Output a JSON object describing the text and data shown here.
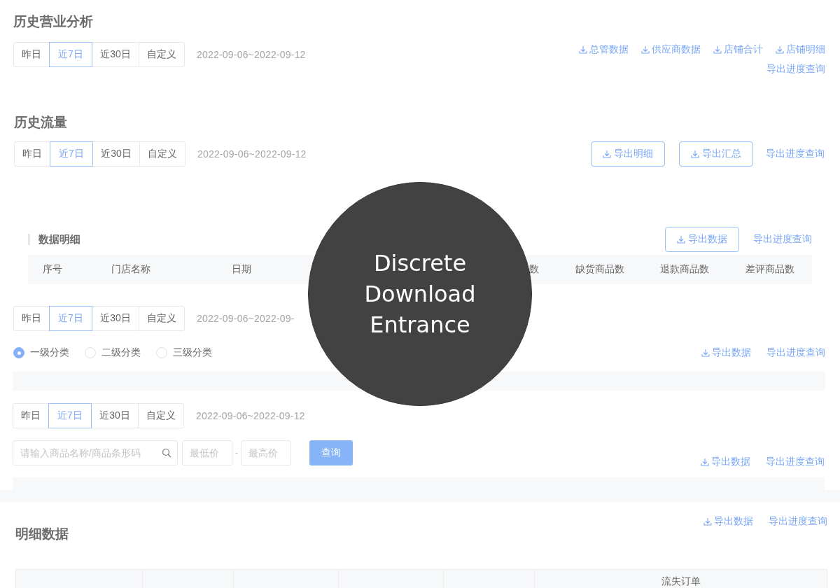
{
  "sections": [
    {
      "kind": "business",
      "title": "历史营业分析",
      "periods": [
        {
          "label": "昨日",
          "selected": false
        },
        {
          "label": "近7日",
          "selected": true
        },
        {
          "label": "近30日",
          "selected": false
        },
        {
          "label": "自定义",
          "selected": false
        }
      ],
      "date_range": "2022-09-06~2022-09-12",
      "export_links": [
        "总管数据",
        "供应商数据",
        "店铺合计",
        "店铺明细"
      ],
      "progress_link": "导出进度查询"
    },
    {
      "kind": "traffic",
      "title": "历史流量",
      "periods": [
        {
          "label": "昨日",
          "selected": false
        },
        {
          "label": "近7日",
          "selected": true
        },
        {
          "label": "近30日",
          "selected": false
        },
        {
          "label": "自定义",
          "selected": false
        }
      ],
      "date_range": "2022-09-06~2022-09-12",
      "export_buttons": [
        "导出明细",
        "导出汇总"
      ],
      "progress_link": "导出进度查询"
    },
    {
      "kind": "detail_table",
      "title": "数据明细",
      "export_button": "导出数据",
      "progress_link": "导出进度查询",
      "columns": [
        "序号",
        "门店名称",
        "日期",
        "数",
        "缺货商品数",
        "退款商品数",
        "差评商品数"
      ]
    },
    {
      "kind": "category_rank",
      "periods": [
        {
          "label": "昨日",
          "selected": false
        },
        {
          "label": "近7日",
          "selected": true
        },
        {
          "label": "近30日",
          "selected": false
        },
        {
          "label": "自定义",
          "selected": false
        }
      ],
      "date_range": "2022-09-06~2022-09-",
      "levels": [
        {
          "label": "一级分类",
          "selected": true
        },
        {
          "label": "二级分类",
          "selected": false
        },
        {
          "label": "三级分类",
          "selected": false
        }
      ],
      "export_link": "导出数据",
      "progress_link": "导出进度查询"
    },
    {
      "kind": "product_rank",
      "periods": [
        {
          "label": "昨日",
          "selected": false
        },
        {
          "label": "近7日",
          "selected": true
        },
        {
          "label": "近30日",
          "selected": false
        },
        {
          "label": "自定义",
          "selected": false
        }
      ],
      "date_range": "2022-09-06~2022-09-12",
      "search": {
        "placeholder": "请输入商品名称/商品条形码"
      },
      "min_price": {
        "placeholder": "最低价"
      },
      "separator": "-",
      "max_price": {
        "placeholder": "最高价"
      },
      "query_button": "查询",
      "export_link": "导出数据",
      "progress_link": "导出进度查询"
    },
    {
      "kind": "detail_data",
      "title": "明细数据",
      "export_link": "导出数据",
      "progress_link": "导出进度查询",
      "group_header": "流失订单"
    }
  ],
  "callout": {
    "text": "Discrete Download Entrance"
  }
}
